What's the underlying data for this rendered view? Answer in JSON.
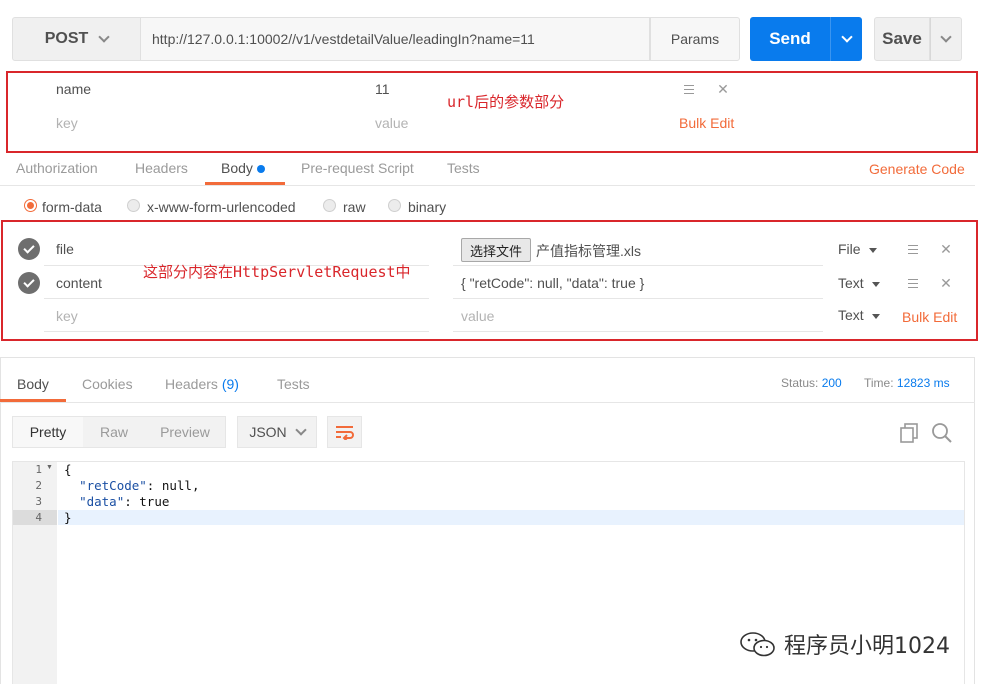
{
  "request": {
    "method": "POST",
    "url": "http://127.0.0.1:10002//v1/vestdetailValue/leadingIn?name=11",
    "params_label": "Params",
    "send_label": "Send",
    "save_label": "Save"
  },
  "params_table": {
    "rows": [
      {
        "key": "name",
        "value": "11"
      }
    ],
    "key_placeholder": "key",
    "value_placeholder": "value",
    "bulk_edit": "Bulk Edit",
    "note": "url后的参数部分"
  },
  "request_tabs": {
    "items": [
      "Authorization",
      "Headers",
      "Body",
      "Pre-request Script",
      "Tests"
    ],
    "active": "Body",
    "generate_code": "Generate Code"
  },
  "body_modes": {
    "items": [
      "form-data",
      "x-www-form-urlencoded",
      "raw",
      "binary"
    ],
    "selected": "form-data"
  },
  "form_data": {
    "rows": [
      {
        "key": "file",
        "choose_button": "选择文件",
        "value": "产值指标管理.xls",
        "type": "File"
      },
      {
        "key": "content",
        "value": "{  \"retCode\": null,  \"data\": true }",
        "type": "Text"
      }
    ],
    "key_placeholder": "key",
    "value_placeholder": "value",
    "new_row_type": "Text",
    "bulk_edit": "Bulk Edit",
    "note": "这部分内容在HttpServletRequest中"
  },
  "response": {
    "tabs": [
      "Body",
      "Cookies",
      "Headers",
      "(9)",
      "Tests"
    ],
    "status_label": "Status:",
    "status_value": "200",
    "time_label": "Time:",
    "time_value": "12823 ms",
    "view_modes": [
      "Pretty",
      "Raw",
      "Preview"
    ],
    "format": "JSON",
    "lines": [
      "1",
      "2",
      "3",
      "4"
    ],
    "code": {
      "open": "{",
      "line2_key": "\"retCode\"",
      "line2_rest": ": null,",
      "line3_key": "\"data\"",
      "line3_rest": ": true",
      "close": "}"
    }
  },
  "watermark": "程序员小明1024",
  "colors": {
    "accent": "#f26b3a",
    "send": "#097bed",
    "annotation": "#d9262b"
  }
}
